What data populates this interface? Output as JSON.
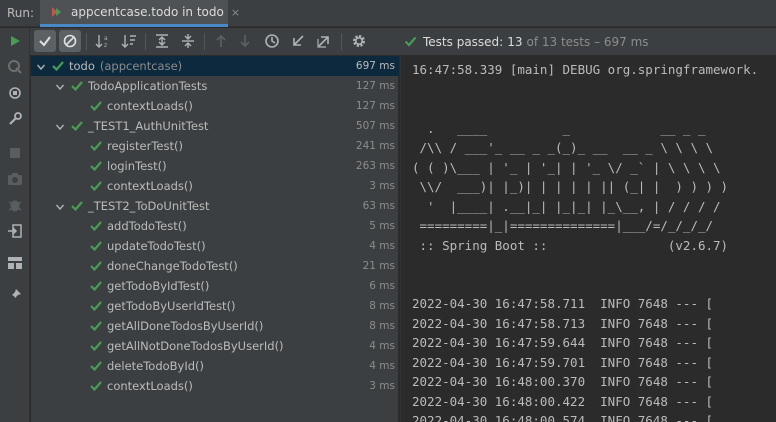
{
  "run": {
    "label": "Run:"
  },
  "tab": {
    "label": "appcentcase.todo in todo",
    "close": "×",
    "icon": "spring-run-icon"
  },
  "toolbar": {
    "buttons": [
      "rerun-icon",
      "show-passed-icon",
      "show-ignored-icon",
      "sort-alpha-icon",
      "sort-duration-icon",
      "expand-all-icon",
      "collapse-all-icon",
      "prev-fail-icon",
      "next-fail-icon",
      "history-icon",
      "import-tests-icon",
      "export-tests-icon",
      "settings-icon"
    ]
  },
  "status": {
    "text": "Tests passed:",
    "count": "13",
    "rest": "of 13 tests – 697 ms"
  },
  "colors": {
    "pass": "#499c54",
    "accent": "#4a88c7",
    "selection": "#0d293e"
  },
  "tree": {
    "rows": [
      {
        "name": "todo",
        "sub": "(appcentcase)",
        "time": "697 ms"
      },
      {
        "name": "TodoApplicationTests",
        "sub": "",
        "time": "127 ms"
      },
      {
        "name": "contextLoads()",
        "sub": "",
        "time": "127 ms"
      },
      {
        "name": "_TEST1_AuthUnitTest",
        "sub": "",
        "time": "507 ms"
      },
      {
        "name": "registerTest()",
        "sub": "",
        "time": "241 ms"
      },
      {
        "name": "loginTest()",
        "sub": "",
        "time": "263 ms"
      },
      {
        "name": "contextLoads()",
        "sub": "",
        "time": "3 ms"
      },
      {
        "name": "_TEST2_ToDoUnitTest",
        "sub": "",
        "time": "63 ms"
      },
      {
        "name": "addTodoTest()",
        "sub": "",
        "time": "5 ms"
      },
      {
        "name": "updateTodoTest()",
        "sub": "",
        "time": "4 ms"
      },
      {
        "name": "doneChangeTodoTest()",
        "sub": "",
        "time": "21 ms"
      },
      {
        "name": "getTodoByIdTest()",
        "sub": "",
        "time": "6 ms"
      },
      {
        "name": "getTodoByUserIdTest()",
        "sub": "",
        "time": "8 ms"
      },
      {
        "name": "getAllDoneTodosByUserId()",
        "sub": "",
        "time": "8 ms"
      },
      {
        "name": "getAllNotDoneTodosByUserId()",
        "sub": "",
        "time": "4 ms"
      },
      {
        "name": "deleteTodoById()",
        "sub": "",
        "time": "4 ms"
      },
      {
        "name": "contextLoads()",
        "sub": "",
        "time": "3 ms"
      }
    ]
  },
  "console": {
    "lines": [
      "16:47:58.339 [main] DEBUG org.springframework.",
      "",
      "",
      "  .   ____          _            __ _ _",
      " /\\\\ / ___'_ __ _ _(_)_ __  __ _ \\ \\ \\ \\",
      "( ( )\\___ | '_ | '_| | '_ \\/ _` | \\ \\ \\ \\",
      " \\\\/  ___)| |_)| | | | | || (_| |  ) ) ) )",
      "  '  |____| .__|_| |_|_| |_\\__, | / / / /",
      " =========|_|==============|___/=/_/_/_/",
      " :: Spring Boot ::                (v2.6.7)",
      "",
      "",
      "2022-04-30 16:47:58.711  INFO 7648 --- [",
      "2022-04-30 16:47:58.713  INFO 7648 --- [",
      "2022-04-30 16:47:59.644  INFO 7648 --- [",
      "2022-04-30 16:47:59.701  INFO 7648 --- [",
      "2022-04-30 16:48:00.370  INFO 7648 --- [",
      "2022-04-30 16:48:00.422  INFO 7648 --- [",
      "2022-04-30 16:48:00.574  INFO 7648 --- ["
    ]
  }
}
